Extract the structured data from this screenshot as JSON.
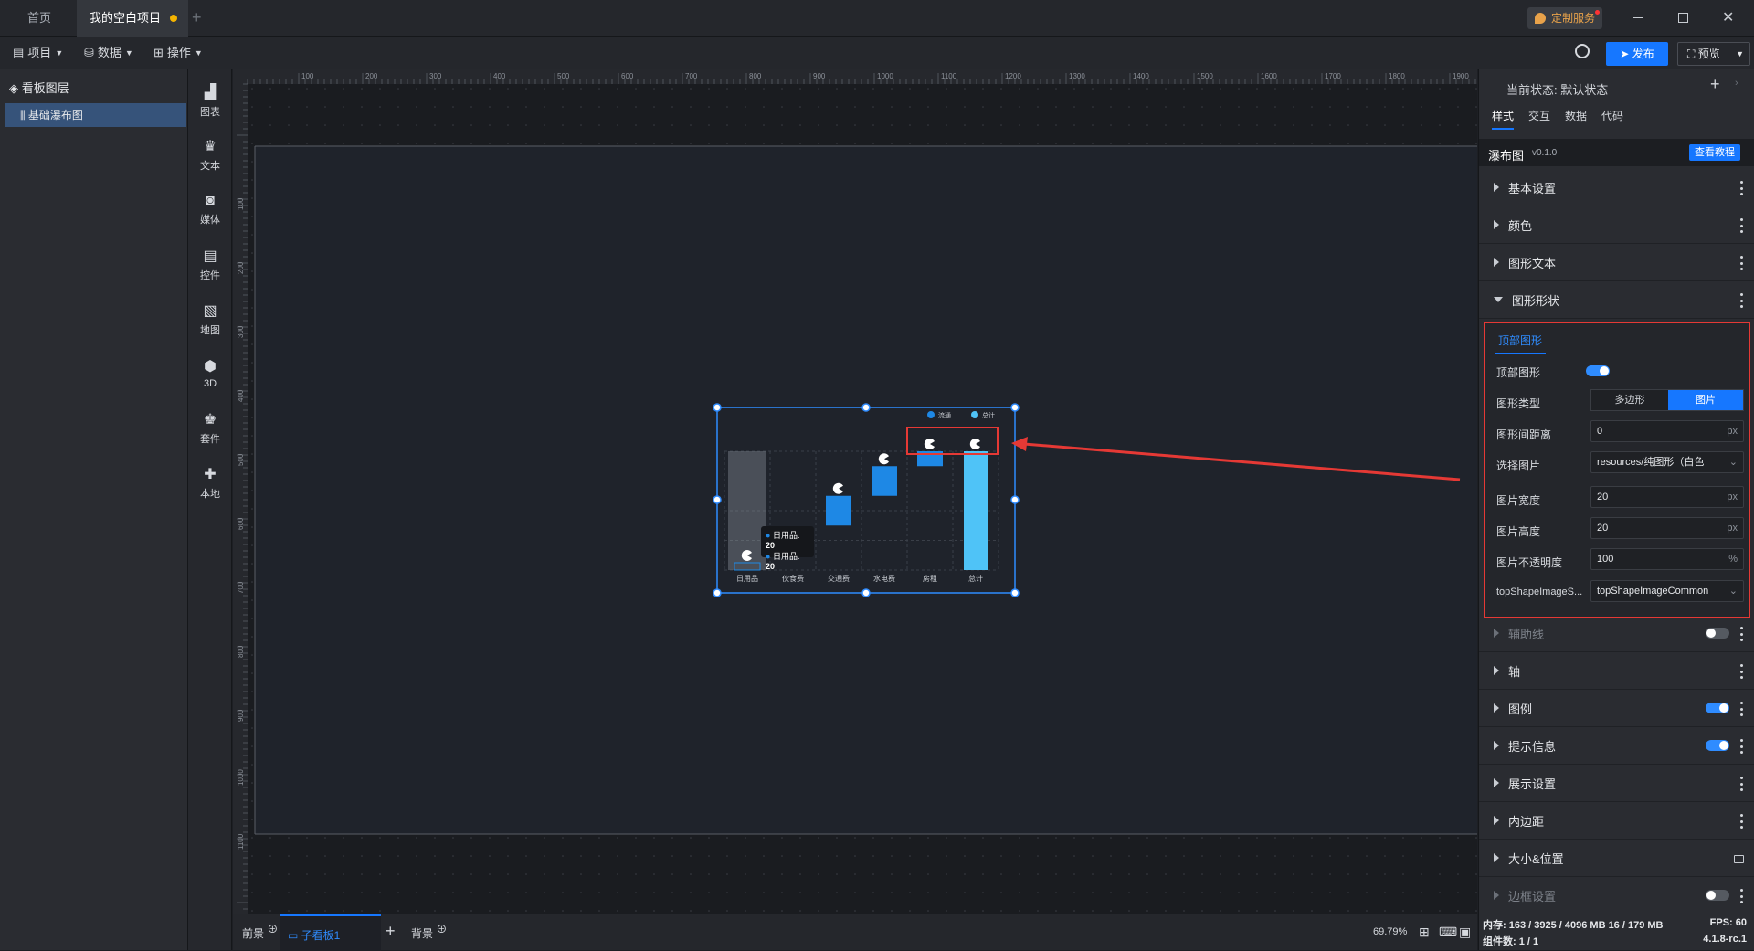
{
  "tabs": [
    {
      "label": "首页"
    },
    {
      "label": "我的空白项目"
    }
  ],
  "header": {
    "custom_service": "定制服务",
    "publish": "发布",
    "preview": "预览"
  },
  "menu": {
    "project": "项目",
    "data": "数据",
    "operate": "操作"
  },
  "layers": {
    "title": "看板图层",
    "items": [
      {
        "label": "基础瀑布图"
      }
    ]
  },
  "tools": [
    {
      "label": "图表",
      "icon": "chart-icon"
    },
    {
      "label": "文本",
      "icon": "text-icon"
    },
    {
      "label": "媒体",
      "icon": "media-icon"
    },
    {
      "label": "控件",
      "icon": "widget-icon"
    },
    {
      "label": "地图",
      "icon": "map-icon"
    },
    {
      "label": "3D",
      "icon": "cube-icon"
    },
    {
      "label": "套件",
      "icon": "kit-icon"
    },
    {
      "label": "本地",
      "icon": "puzzle-icon"
    }
  ],
  "ruler": {
    "top": [
      "100",
      "200",
      "300",
      "400",
      "500",
      "600",
      "700",
      "800",
      "900",
      "1000",
      "1100",
      "1200",
      "1300",
      "1400",
      "1500",
      "1600",
      "1700",
      "1800",
      "1900"
    ],
    "left": [
      "100",
      "200",
      "300",
      "400",
      "500",
      "600",
      "700",
      "800",
      "900",
      "1000",
      "1100"
    ]
  },
  "chart_data": {
    "type": "bar",
    "categories": [
      "日用品",
      "伙食费",
      "交通费",
      "水电费",
      "房租",
      "总计"
    ],
    "legend": [
      "流通",
      "总计"
    ],
    "series": [
      {
        "name": "流通",
        "base": [
          0,
          20,
          60,
          100,
          140,
          0
        ],
        "values": [
          20,
          40,
          40,
          40,
          20,
          160
        ]
      }
    ],
    "ylim": [
      0,
      160
    ],
    "tooltip": [
      {
        "label": "日用品:",
        "value": "20"
      },
      {
        "label": "日用品:",
        "value": "20"
      }
    ],
    "colors": {
      "bar": "#1e88e5",
      "total": "#4fc3f7",
      "highlight": "#9aa3ad"
    }
  },
  "panel": {
    "state_label": "当前状态:",
    "state_value": "默认状态",
    "tabs": [
      "样式",
      "交互",
      "数据",
      "代码"
    ],
    "component": "瀑布图",
    "version": "v0.1.0",
    "tutorial": "查看教程",
    "sections": [
      {
        "label": "基本设置"
      },
      {
        "label": "颜色"
      },
      {
        "label": "图形文本"
      },
      {
        "label": "图形形状"
      }
    ],
    "subtab": "顶部图形",
    "rows": {
      "top_shape": "顶部图形",
      "shape_type": "图形类型",
      "type_opts": [
        "多边形",
        "图片"
      ],
      "gap": "图形间距离",
      "gap_val": "0",
      "px": "px",
      "image": "选择图片",
      "image_val": "resources/纯图形（白色",
      "w": "图片宽度",
      "w_val": "20",
      "h": "图片高度",
      "h_val": "20",
      "op": "图片不透明度",
      "op_val": "100",
      "pct": "%",
      "style": "topShapeImageS...",
      "style_val": "topShapeImageCommon"
    },
    "lower_sections": [
      {
        "label": "辅助线"
      },
      {
        "label": "轴"
      },
      {
        "label": "图例"
      },
      {
        "label": "提示信息"
      },
      {
        "label": "展示设置"
      },
      {
        "label": "内边距"
      },
      {
        "label": "大小&位置"
      },
      {
        "label": "边框设置"
      }
    ]
  },
  "bottom": {
    "front": "前景",
    "sub": "子看板1",
    "back": "背景",
    "zoom": "69.79%"
  },
  "status": {
    "mem": "内存: 163 / 3925 / 4096 MB 16 / 179 MB",
    "fps": "FPS: 60",
    "count": "组件数: 1 / 1",
    "ver": "4.1.8-rc.1"
  },
  "accent": "#1677ff"
}
